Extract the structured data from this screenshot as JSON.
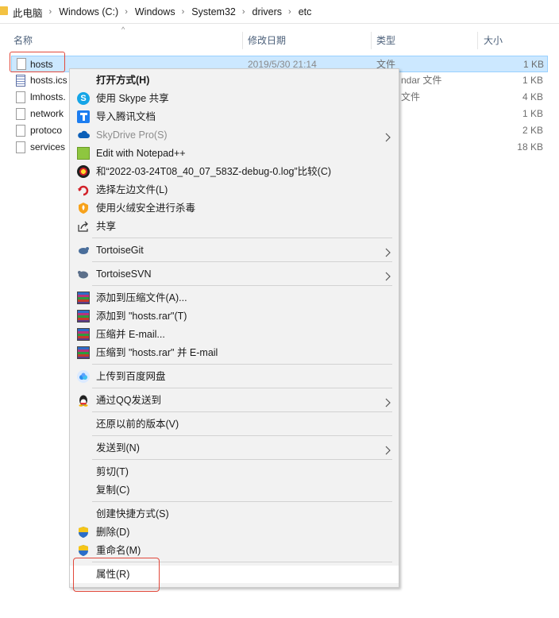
{
  "address_bar": {
    "crumbs": [
      "此电脑",
      "Windows (C:)",
      "Windows",
      "System32",
      "drivers",
      "etc"
    ],
    "separator": "›"
  },
  "columns": {
    "name": "名称",
    "date": "修改日期",
    "type": "类型",
    "size": "大小"
  },
  "files": [
    {
      "name": "hosts",
      "date": "2019/5/30 21:14",
      "type": "文件",
      "size": "1 KB",
      "icon": "file-icon",
      "selected": true
    },
    {
      "name": "hosts.ics",
      "date": "",
      "type": "ndar 文件",
      "size": "1 KB",
      "icon": "calendar-file-icon"
    },
    {
      "name": "lmhosts.",
      "date": "",
      "type": "文件",
      "size": "4 KB",
      "icon": "file-icon"
    },
    {
      "name": "network",
      "date": "",
      "type": "",
      "size": "1 KB",
      "icon": "file-icon"
    },
    {
      "name": "protoco",
      "date": "",
      "type": "",
      "size": "2 KB",
      "icon": "file-icon"
    },
    {
      "name": "services",
      "date": "",
      "type": "",
      "size": "18 KB",
      "icon": "file-icon"
    }
  ],
  "context_menu": {
    "items": [
      {
        "label": "打开方式(H)",
        "icon": "",
        "bold": true
      },
      {
        "label": "使用 Skype 共享",
        "icon": "skype-icon"
      },
      {
        "label": "导入腾讯文档",
        "icon": "tencent-docs-icon"
      },
      {
        "label": "SkyDrive Pro(S)",
        "icon": "skydrive-icon",
        "disabled": true,
        "submenu": true
      },
      {
        "label": "Edit with Notepad++",
        "icon": "notepad-plus-plus-icon"
      },
      {
        "label": "和“2022-03-24T08_40_07_583Z-debug-0.log”比较(C)",
        "icon": "compare-icon"
      },
      {
        "label": "选择左边文件(L)",
        "icon": "select-left-icon"
      },
      {
        "label": "使用火绒安全进行杀毒",
        "icon": "huorong-icon"
      },
      {
        "label": "共享",
        "icon": "share-icon"
      },
      {
        "label": "TortoiseGit",
        "icon": "tortoisegit-icon",
        "submenu": true
      },
      {
        "label": "TortoiseSVN",
        "icon": "tortoisesvn-icon",
        "submenu": true
      },
      {
        "label": "添加到压缩文件(A)...",
        "icon": "winrar-icon"
      },
      {
        "label": "添加到 \"hosts.rar\"(T)",
        "icon": "winrar-icon"
      },
      {
        "label": "压缩并 E-mail...",
        "icon": "winrar-icon"
      },
      {
        "label": "压缩到 \"hosts.rar\" 并 E-mail",
        "icon": "winrar-icon"
      },
      {
        "label": "上传到百度网盘",
        "icon": "baidu-netdisk-icon"
      },
      {
        "label": "通过QQ发送到",
        "icon": "qq-icon",
        "submenu": true
      },
      {
        "label": "还原以前的版本(V)",
        "icon": ""
      },
      {
        "label": "发送到(N)",
        "icon": "",
        "submenu": true
      },
      {
        "label": "剪切(T)",
        "icon": ""
      },
      {
        "label": "复制(C)",
        "icon": ""
      },
      {
        "label": "创建快捷方式(S)",
        "icon": ""
      },
      {
        "label": "删除(D)",
        "icon": "uac-shield-icon"
      },
      {
        "label": "重命名(M)",
        "icon": "uac-shield-icon"
      },
      {
        "label": "属性(R)",
        "icon": ""
      }
    ]
  },
  "colors": {
    "selection_bg": "#cce8ff",
    "highlight_box": "#e2483b",
    "menu_bg": "#f2f2f2"
  }
}
